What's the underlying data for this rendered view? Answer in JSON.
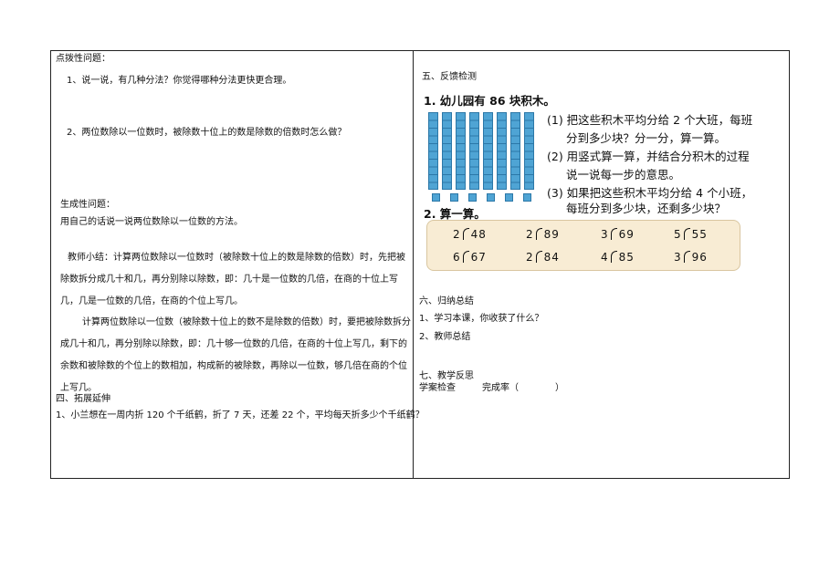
{
  "left": {
    "heading_hint": "点拨性问题：",
    "q1": "1、说一说，有几种分法？你觉得哪种分法更快更合理。",
    "q2": "2、两位数除以一位数时，被除数十位上的数是除数的倍数时怎么做？",
    "heading_generate": "生成性问题：",
    "generate_text": "用自己的话说一说两位数除以一位数的方法。",
    "summary_1": "教师小结：计算两位数除以一位数时（被除数十位上的数是除数的倍数）时，先把被除数拆分成几十和几，再分别除以除数，即：几十是一位数的几倍，在商的十位上写几，几是一位数的几倍，在商的个位上写几。",
    "summary_2": "计算两位数除以一位数（被除数十位上的数不是除数的倍数）时，要把被除数拆分成几十和几，再分别除以除数，即：几十够一位数的几倍，在商的十位上写几，剩下的余数和被除数的个位上的数相加，构成新的被除数，再除以一位数，够几倍在商的个位上写几。",
    "heading_extend": "四、拓展延伸",
    "extend_q1": "1、小兰想在一周内折 120 个千纸鹤，折了 7 天，还差 22 个，平均每天折多少个千纸鹤？"
  },
  "right": {
    "heading_feedback": "五、反馈检测",
    "exercise": {
      "title": "1. 幼儿园有 86 块积木。",
      "q1_a": "(1)  把这些积木平均分给 2 个大班，每班",
      "q1_b": "分到多少块？分一分，算一算。",
      "q2_a": "(2)  用竖式算一算，并结合分积木的过程",
      "q2_b": "说一说每一步的意思。",
      "q3_a": "(3)  如果把这些积木平均分给 4 个小班，",
      "q3_b": "每班分到多少块，还剩多少块？",
      "title2": "2. 算一算。",
      "divisions": [
        {
          "divisor": "2",
          "dividend": "48"
        },
        {
          "divisor": "2",
          "dividend": "89"
        },
        {
          "divisor": "3",
          "dividend": "69"
        },
        {
          "divisor": "5",
          "dividend": "55"
        },
        {
          "divisor": "6",
          "dividend": "67"
        },
        {
          "divisor": "2",
          "dividend": "84"
        },
        {
          "divisor": "4",
          "dividend": "85"
        },
        {
          "divisor": "3",
          "dividend": "96"
        }
      ],
      "bars": 8,
      "cubes": 6,
      "block_color": "#4fa4d4",
      "box_color": "#f8ecd4"
    },
    "heading_summary": "六、归纳总结",
    "summary_q1": "1、学习本课，你收获了什么？",
    "summary_q2": "2、教师总结",
    "heading_reflect": "七、教学反思",
    "check_label": "学案检查",
    "rate_label": "完成率（",
    "rate_close": "）"
  }
}
